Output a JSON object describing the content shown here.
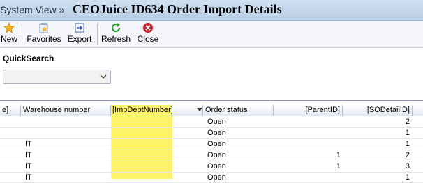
{
  "window": {
    "breadcrumb": "System View »",
    "title": "CEOJuice ID634 Order Import Details"
  },
  "toolbar": {
    "new_label": "New",
    "favorites_label": "Favorites",
    "export_label": "Export",
    "refresh_label": "Refresh",
    "close_label": "Close"
  },
  "quicksearch": {
    "label": "QuickSearch",
    "selected_value": ""
  },
  "grid": {
    "columns": [
      "e]",
      "Warehouse number",
      "[ImpDeptNumber]",
      "Order status",
      "[ParentID]",
      "[SODetailID]"
    ],
    "rows": [
      {
        "warehouse": "",
        "dept": "",
        "status": "Open",
        "parent": "",
        "sodetail": "2"
      },
      {
        "warehouse": "",
        "dept": "",
        "status": "Open",
        "parent": "",
        "sodetail": "1"
      },
      {
        "warehouse": "IT",
        "dept": "",
        "status": "Open",
        "parent": "",
        "sodetail": "1"
      },
      {
        "warehouse": "IT",
        "dept": "",
        "status": "Open",
        "parent": "1",
        "sodetail": "2"
      },
      {
        "warehouse": "IT",
        "dept": "",
        "status": "Open",
        "parent": "1",
        "sodetail": "3"
      },
      {
        "warehouse": "IT",
        "dept": "",
        "status": "Open",
        "parent": "",
        "sodetail": "1"
      }
    ]
  },
  "colors": {
    "highlight": "#fff36b",
    "titlebar": "#c4d7ec"
  }
}
